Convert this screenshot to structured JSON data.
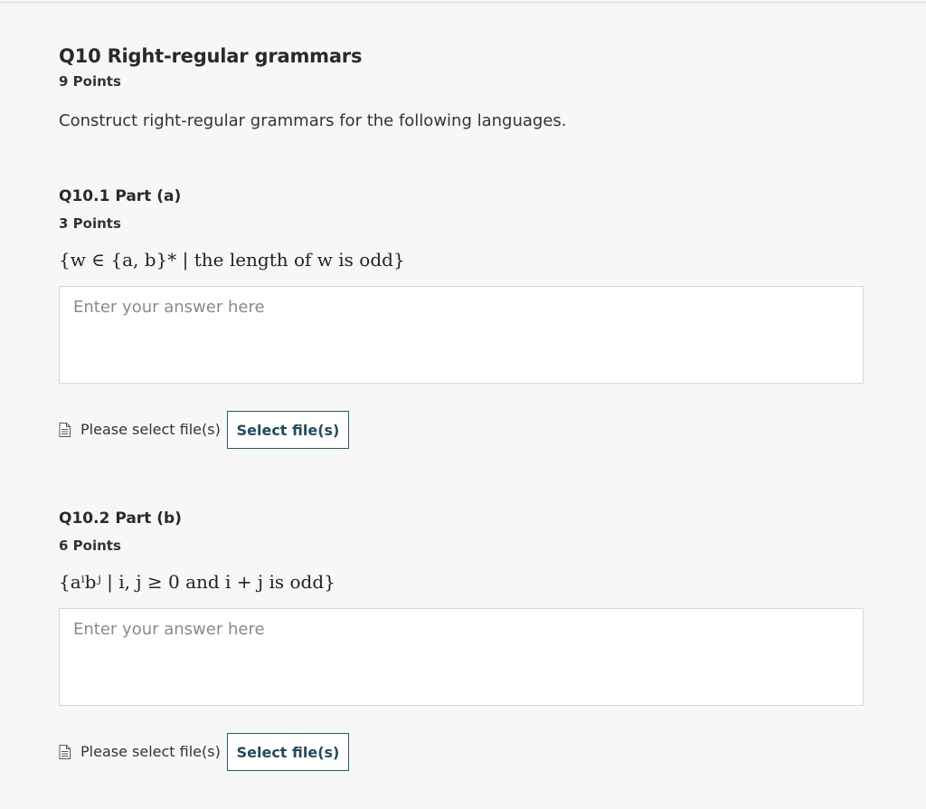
{
  "question": {
    "title": "Q10 Right-regular grammars",
    "points": "9 Points",
    "description": "Construct right-regular grammars for the following languages."
  },
  "parts": [
    {
      "title": "Q10.1 Part (a)",
      "points": "3 Points",
      "language": "{w ∈ {a, b}* | the length of w is odd}",
      "answer_value": "",
      "answer_placeholder": "Enter your answer here",
      "file_status": "Please select file(s)",
      "file_button_label": "Select file(s)",
      "file_icon": "document-icon"
    },
    {
      "title": "Q10.2 Part (b)",
      "points": "6 Points",
      "language": "{aⁱbʲ | i, j ≥ 0 and i + j is odd}",
      "answer_value": "",
      "answer_placeholder": "Enter your answer here",
      "file_status": "Please select file(s)",
      "file_button_label": "Select file(s)",
      "file_icon": "document-icon"
    }
  ],
  "colors": {
    "page_background": "#f7f7f7",
    "button_border": "#2f5a6e",
    "button_text": "#234a5e"
  }
}
